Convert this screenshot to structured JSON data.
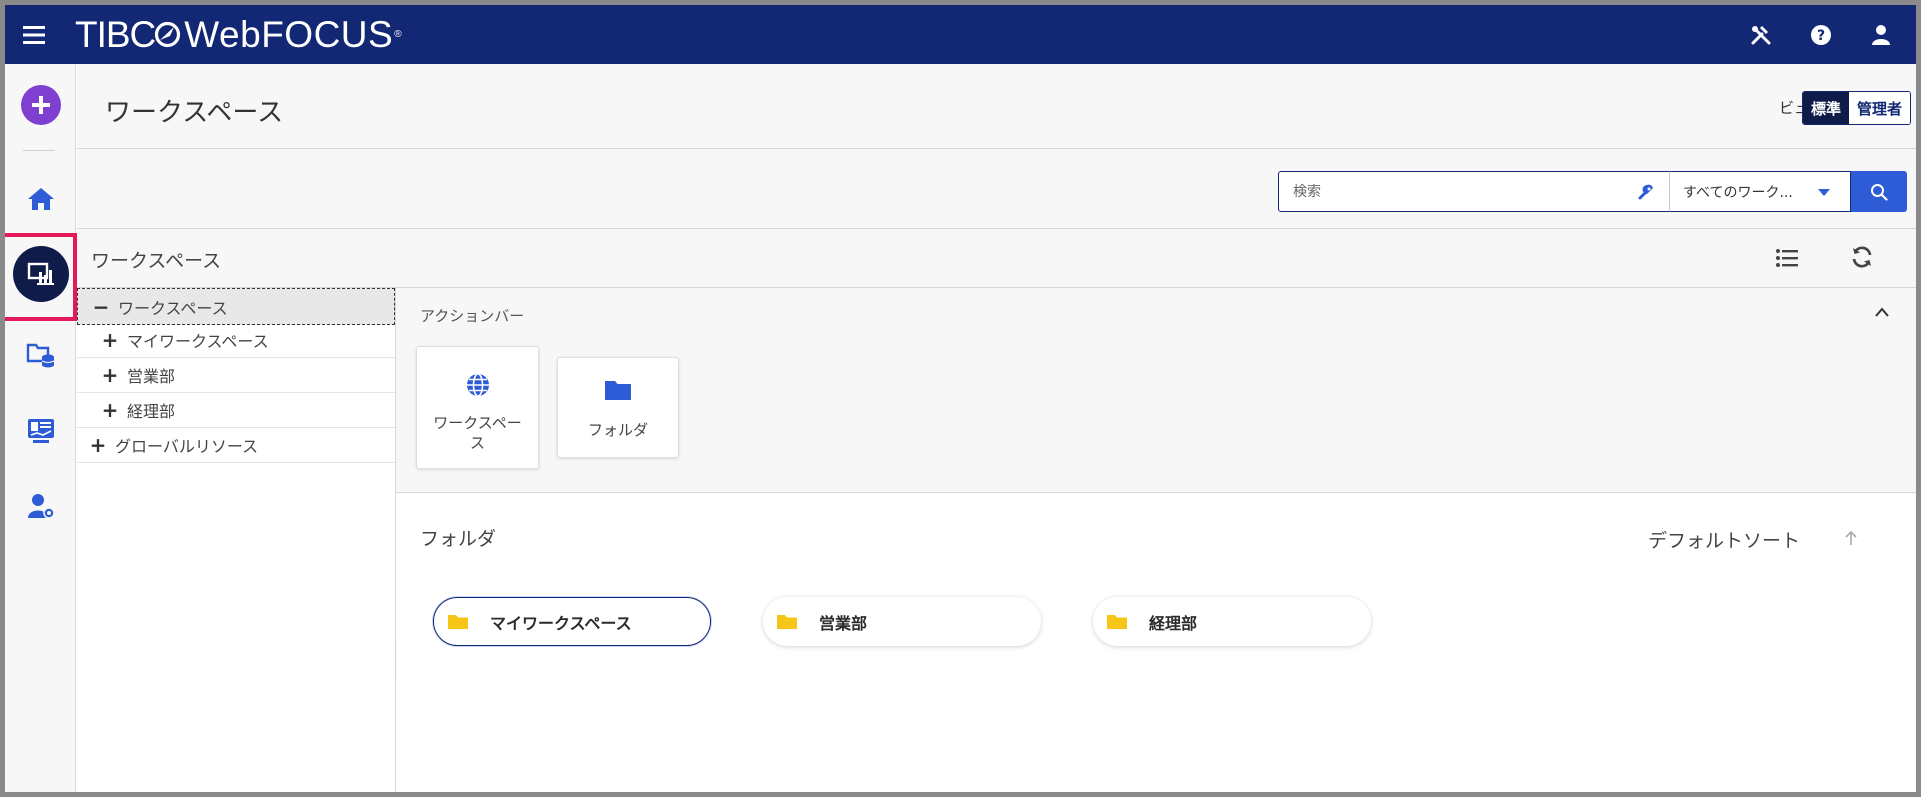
{
  "topbar": {
    "brand_tibco": "TIBC",
    "brand_product": "WebFOCUS",
    "brand_reg": "®",
    "icons": [
      "menu-icon",
      "tools-icon",
      "help-icon",
      "user-icon"
    ]
  },
  "rail": {
    "items": [
      "create-icon",
      "home-icon",
      "workspaces-icon",
      "data-folder-icon",
      "monitor-icon",
      "user-settings-icon"
    ],
    "active": "workspaces-icon",
    "highlight_color": "#e3195a"
  },
  "header": {
    "title": "ワークスペース",
    "view_label": "ビュー",
    "view_standard": "標準",
    "view_admin": "管理者"
  },
  "search": {
    "placeholder": "検索",
    "scope": "すべてのワーク..."
  },
  "workspace_bar": {
    "title": "ワークスペース"
  },
  "tree": {
    "items": [
      {
        "label": "ワークスペース",
        "symbol": "−",
        "level": 0,
        "selected": true
      },
      {
        "label": "マイワークスペース",
        "symbol": "+",
        "level": 1
      },
      {
        "label": "営業部",
        "symbol": "+",
        "level": 1
      },
      {
        "label": "経理部",
        "symbol": "+",
        "level": 1
      },
      {
        "label": "グローバルリソース",
        "symbol": "+",
        "level": 0
      }
    ]
  },
  "action_bar": {
    "title": "アクションバー",
    "tiles": [
      {
        "label": "ワークスペース",
        "icon": "globe-icon"
      },
      {
        "label": "フォルダ",
        "icon": "folder-icon"
      }
    ]
  },
  "folders": {
    "title": "フォルダ",
    "sort_label": "デフォルトソート",
    "items": [
      {
        "label": "マイワークスペース",
        "active": true
      },
      {
        "label": "営業部"
      },
      {
        "label": "経理部"
      }
    ]
  },
  "colors": {
    "topbar": "#132874",
    "accent": "#2e5bd6",
    "create": "#7f3fd1",
    "folder": "#f5c518"
  }
}
